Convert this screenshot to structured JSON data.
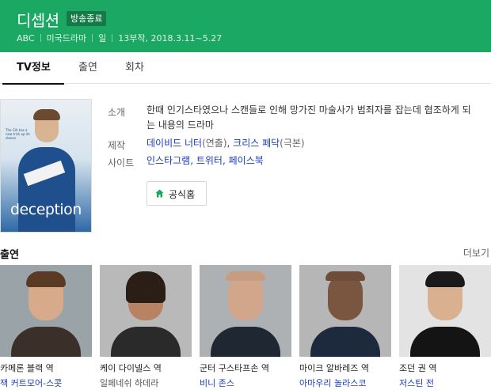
{
  "header": {
    "title": "디셉션",
    "status": "방송종료",
    "meta": {
      "network": "ABC",
      "genre": "미국드라마",
      "day": "일",
      "episodes_period": "13부작, 2018.3.11~5.27"
    }
  },
  "tabs": [
    {
      "label": "TV정보",
      "active": true
    },
    {
      "label": "출연",
      "active": false
    },
    {
      "label": "회차",
      "active": false
    }
  ],
  "poster": {
    "logo_text": "deception",
    "tagline": "The CIA has a new trick up its sleeve"
  },
  "info": {
    "synopsis_label": "소개",
    "synopsis": "한때 인기스타였으나 스캔들로 인해 망가진 마술사가 범죄자를 잡는데 협조하게 되는 내용의 드라마",
    "production_label": "제작",
    "director": "데이비드 너터",
    "director_role": "(연출)",
    "production_sep": ", ",
    "writer": "크리스 페닥",
    "writer_role": "(극본)",
    "site_label": "사이트",
    "sites": [
      "인스타그램",
      "트위터",
      "페이스북"
    ],
    "official_home_label": "공식홈"
  },
  "cast_section": {
    "title": "출연",
    "more_label": "더보기",
    "members": [
      {
        "role": "카메론 블랙 역",
        "actor": "잭 커트모어-스콧",
        "linked": true
      },
      {
        "role": "케이 다이넬스 역",
        "actor": "일페네쉬 하데라",
        "linked": false
      },
      {
        "role": "군터 구스타프손 역",
        "actor": "비니 존스",
        "linked": true
      },
      {
        "role": "마이크 알바레즈 역",
        "actor": "아마우리 놀라스코",
        "linked": true
      },
      {
        "role": "조던 권 역",
        "actor": "저스틴 전",
        "linked": true
      }
    ]
  },
  "colors": {
    "header_bg": "#1ba862",
    "badge_bg": "#157a47",
    "link": "#1a3cbd"
  }
}
